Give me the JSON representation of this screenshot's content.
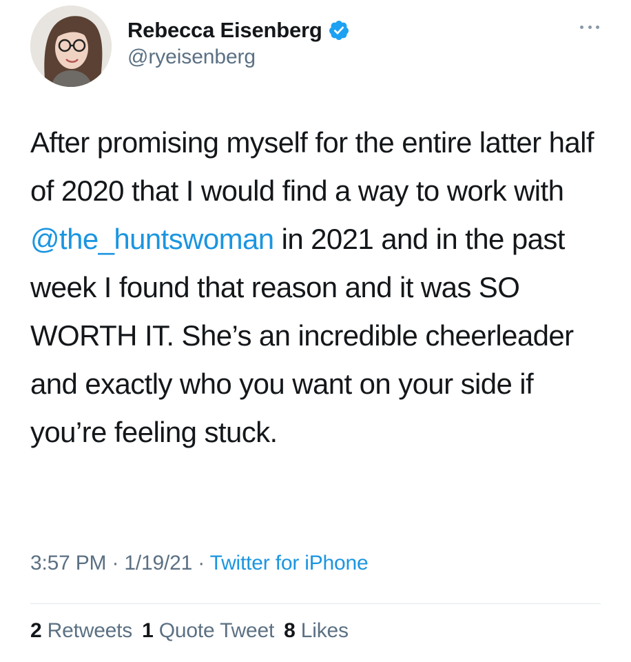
{
  "author": {
    "display_name": "Rebecca Eisenberg",
    "handle": "@ryeisenberg",
    "verified": true,
    "avatar_icon": "profile-photo"
  },
  "menu_icon": "more-horizontal-icon",
  "tweet": {
    "text_part1": "After promising myself for the entire latter half of 2020 that I would find a way to work with ",
    "mention": "@the_huntswoman",
    "text_part2": " in 2021 and in the past week I found that reason and it was SO WORTH IT. She’s an incredible cheerleader and exactly who you want on your side if you’re feeling stuck."
  },
  "meta": {
    "time": "3:57 PM",
    "separator1": " · ",
    "date": "1/19/21",
    "separator2": " · ",
    "source": "Twitter for iPhone"
  },
  "stats": {
    "retweets_count": "2",
    "retweets_label": "Retweets",
    "quotes_count": "1",
    "quotes_label": "Quote Tweet",
    "likes_count": "8",
    "likes_label": "Likes"
  },
  "colors": {
    "link": "#1b95e0",
    "secondary_text": "#5b7083",
    "primary_text": "#14171a",
    "verified_badge": "#1da1f2"
  }
}
